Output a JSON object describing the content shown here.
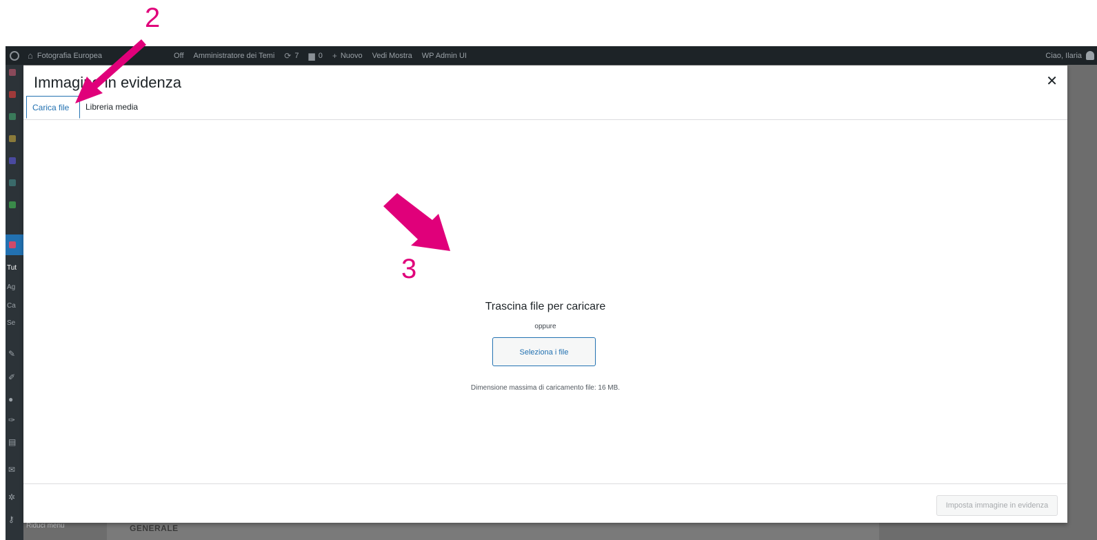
{
  "annotations": {
    "step_2": "2",
    "step_3": "3"
  },
  "admin_bar": {
    "site_name": "Fotografia Europea",
    "off_label": "Off",
    "theme_admin": "Amministratore dei Temi",
    "updates_count": "7",
    "comments_count": "0",
    "new_label": "Nuovo",
    "view_label": "Vedi Mostra",
    "wp_admin_ui": "WP Admin UI",
    "greeting": "Ciao, Ilaria"
  },
  "sidebar": {
    "texts": [
      "Tut",
      "Ag",
      "Ca",
      "Se"
    ],
    "collapse_label": "Riduci menu"
  },
  "background": {
    "section_label": "GENERALE"
  },
  "modal": {
    "title": "Immagine in evidenza",
    "close_icon": "close-icon",
    "tabs": [
      {
        "label": "Carica file",
        "active": true
      },
      {
        "label": "Libreria media",
        "active": false
      }
    ],
    "upload": {
      "title": "Trascina file per caricare",
      "or": "oppure",
      "button": "Seleziona i file",
      "max_size": "Dimensione massima di caricamento file: 16 MB."
    },
    "footer_button": "Imposta immagine in evidenza"
  },
  "colors": {
    "annotation": "#e0007a",
    "accent": "#2271b1",
    "admin_bar": "#1d2327"
  }
}
